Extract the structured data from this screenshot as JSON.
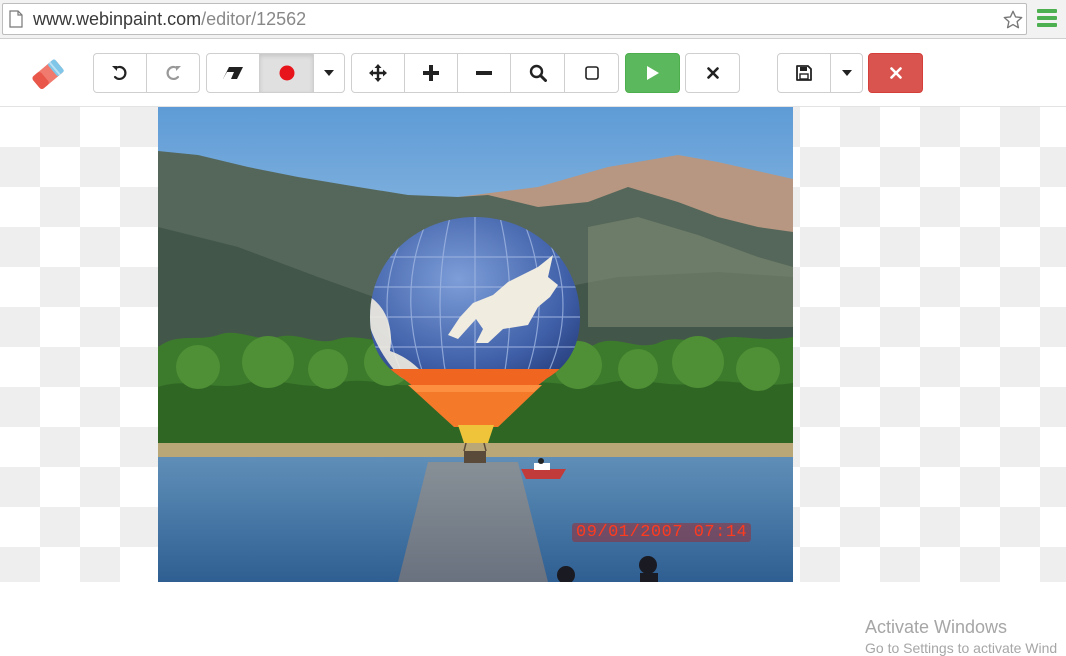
{
  "browser": {
    "url_host": "www.webinpaint.com",
    "url_path": "/editor/12562"
  },
  "toolbar": {
    "logo": "eraser-logo-icon",
    "buttons": [
      {
        "name": "undo-button",
        "icon": "undo-icon"
      },
      {
        "name": "redo-button",
        "icon": "redo-icon"
      },
      {
        "name": "eraser-tool-button",
        "icon": "eraser-icon"
      },
      {
        "name": "marker-tool-button",
        "icon": "red-dot-icon",
        "active": true
      },
      {
        "name": "marker-options-dropdown",
        "icon": "caret-down-icon"
      },
      {
        "name": "move-button",
        "icon": "move-arrows-icon"
      },
      {
        "name": "zoom-in-button",
        "icon": "plus-icon"
      },
      {
        "name": "zoom-out-button",
        "icon": "minus-icon"
      },
      {
        "name": "zoom-fit-button",
        "icon": "search-icon"
      },
      {
        "name": "select-area-button",
        "icon": "square-icon"
      },
      {
        "name": "run-button",
        "icon": "play-icon"
      },
      {
        "name": "clear-button",
        "icon": "close-icon"
      },
      {
        "name": "save-button",
        "icon": "floppy-disk-icon"
      },
      {
        "name": "save-options-dropdown",
        "icon": "caret-down-icon"
      },
      {
        "name": "close-editor-button",
        "icon": "close-icon"
      }
    ],
    "colors": {
      "run": "#5cb85c",
      "close": "#d9534f",
      "marker": "#e8141b"
    }
  },
  "canvas": {
    "photo_timestamp": "09/01/2007 07:14"
  },
  "watermark": {
    "line1": "Activate Windows",
    "line2": "Go to Settings to activate Wind"
  }
}
